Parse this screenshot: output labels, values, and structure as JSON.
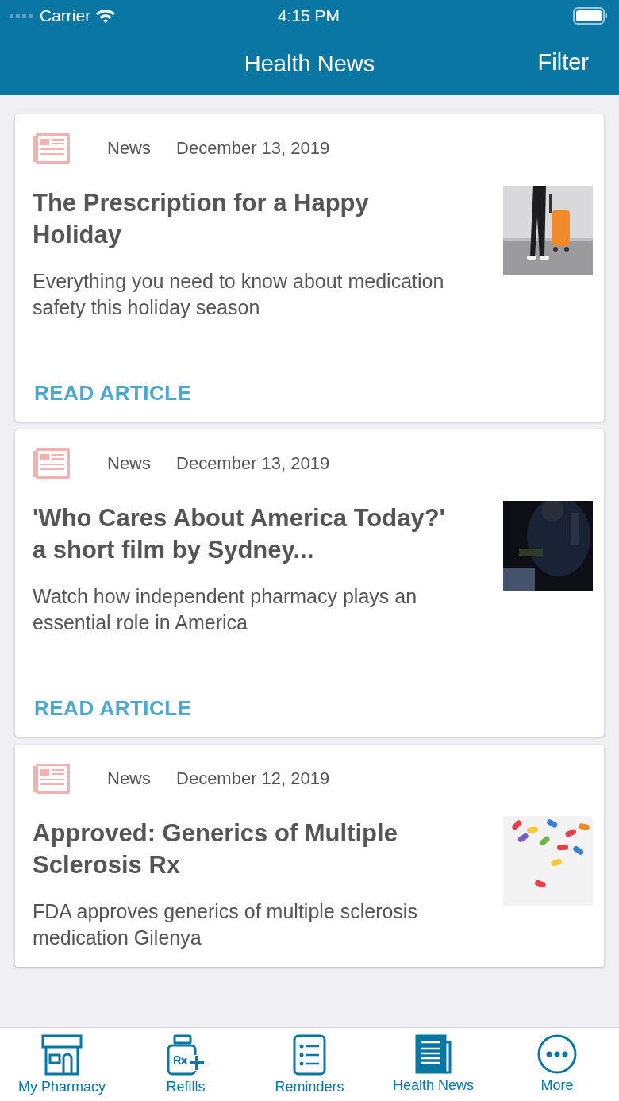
{
  "status_bar": {
    "carrier": "Carrier",
    "time": "4:15 PM"
  },
  "nav_bar": {
    "title": "Health News",
    "action": "Filter"
  },
  "articles": [
    {
      "category": "News",
      "date": "December 13, 2019",
      "title": "The Prescription for a Happy Holiday",
      "summary": "Everything you need to know about medication safety this holiday season",
      "link": "READ ARTICLE"
    },
    {
      "category": "News",
      "date": "December 13, 2019",
      "title": "'Who Cares About America Today?' a short film by Sydney...",
      "summary": "Watch how independent pharmacy plays an essential role in America",
      "link": "READ ARTICLE"
    },
    {
      "category": "News",
      "date": "December 12, 2019",
      "title": "Approved: Generics of Multiple Sclerosis Rx",
      "summary": "FDA approves generics of multiple sclerosis medication Gilenya"
    }
  ],
  "tab_bar": [
    {
      "kind": "store",
      "label": "My Pharmacy",
      "selected": false
    },
    {
      "kind": "refill",
      "label": "Refills",
      "selected": false
    },
    {
      "kind": "list",
      "label": "Reminders",
      "selected": false
    },
    {
      "kind": "newspaper",
      "label": "Health News",
      "selected": true
    },
    {
      "kind": "more",
      "label": "More",
      "selected": false
    }
  ]
}
